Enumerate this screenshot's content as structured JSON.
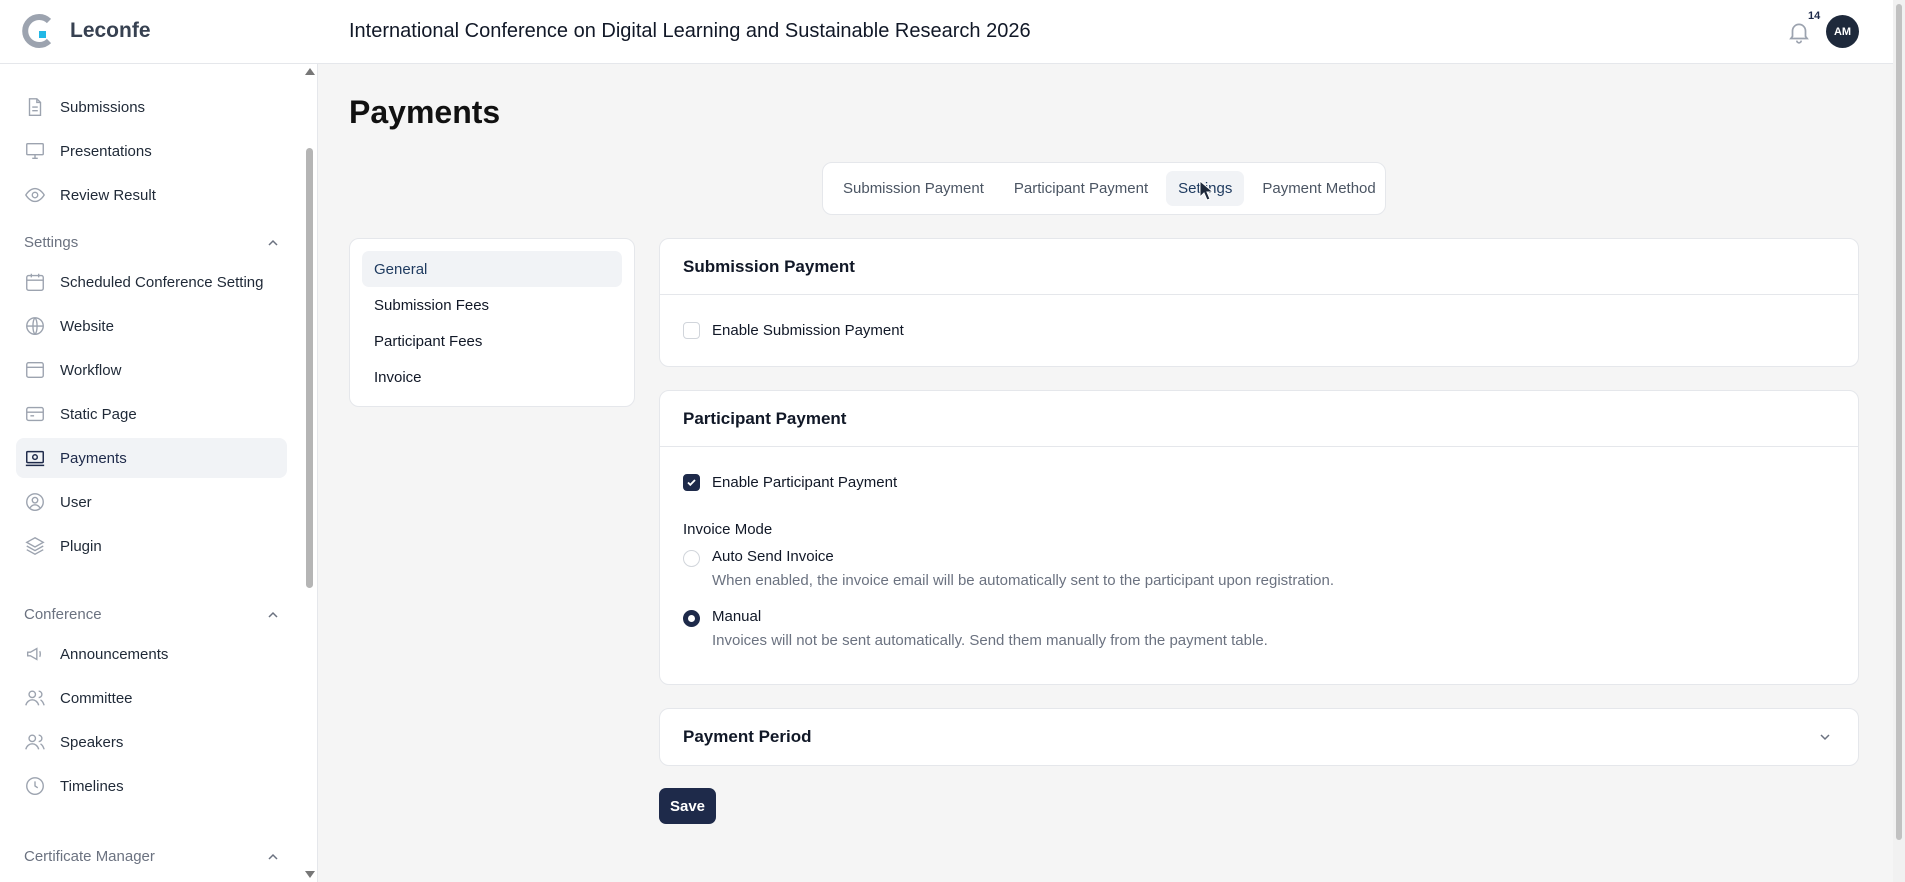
{
  "app": {
    "name": "Leconfe",
    "conference_title": "International Conference on Digital Learning and Sustainable Research 2026"
  },
  "header": {
    "notification_count": "14",
    "avatar_initials": "AM"
  },
  "sidebar": {
    "items_top": [
      {
        "label": "Submissions",
        "icon": "document-icon"
      },
      {
        "label": "Presentations",
        "icon": "presentation-icon"
      },
      {
        "label": "Review Result",
        "icon": "eye-icon"
      }
    ],
    "settings_group": "Settings",
    "settings_items": [
      {
        "label": "Scheduled Conference Setting",
        "icon": "calendar-icon"
      },
      {
        "label": "Website",
        "icon": "globe-icon"
      },
      {
        "label": "Workflow",
        "icon": "window-icon"
      },
      {
        "label": "Static Page",
        "icon": "page-icon"
      },
      {
        "label": "Payments",
        "icon": "payment-icon",
        "active": true
      },
      {
        "label": "User",
        "icon": "user-icon"
      },
      {
        "label": "Plugin",
        "icon": "layers-icon"
      }
    ],
    "conference_group": "Conference",
    "conference_items": [
      {
        "label": "Announcements",
        "icon": "megaphone-icon"
      },
      {
        "label": "Committee",
        "icon": "users-icon"
      },
      {
        "label": "Speakers",
        "icon": "speakers-icon"
      },
      {
        "label": "Timelines",
        "icon": "clock-icon"
      }
    ],
    "certificate_group": "Certificate Manager"
  },
  "main": {
    "title": "Payments",
    "tabs": [
      "Submission Payment",
      "Participant Payment",
      "Settings",
      "Payment Method"
    ],
    "active_tab": "Settings",
    "subnav": [
      "General",
      "Submission Fees",
      "Participant Fees",
      "Invoice"
    ],
    "active_subnav": "General",
    "submission_payment": {
      "title": "Submission Payment",
      "enable_label": "Enable Submission Payment",
      "enabled": false
    },
    "participant_payment": {
      "title": "Participant Payment",
      "enable_label": "Enable Participant Payment",
      "enabled": true,
      "invoice_mode_label": "Invoice Mode",
      "options": [
        {
          "title": "Auto Send Invoice",
          "desc": "When enabled, the invoice email will be automatically sent to the participant upon registration.",
          "selected": false
        },
        {
          "title": "Manual",
          "desc": "Invoices will not be sent automatically. Send them manually from the payment table.",
          "selected": true
        }
      ]
    },
    "payment_period": {
      "title": "Payment Period"
    },
    "save_label": "Save"
  },
  "colors": {
    "primary": "#1e2a4a",
    "active_bg": "#f1f3f6",
    "logo_accent": "#22b8e6"
  }
}
